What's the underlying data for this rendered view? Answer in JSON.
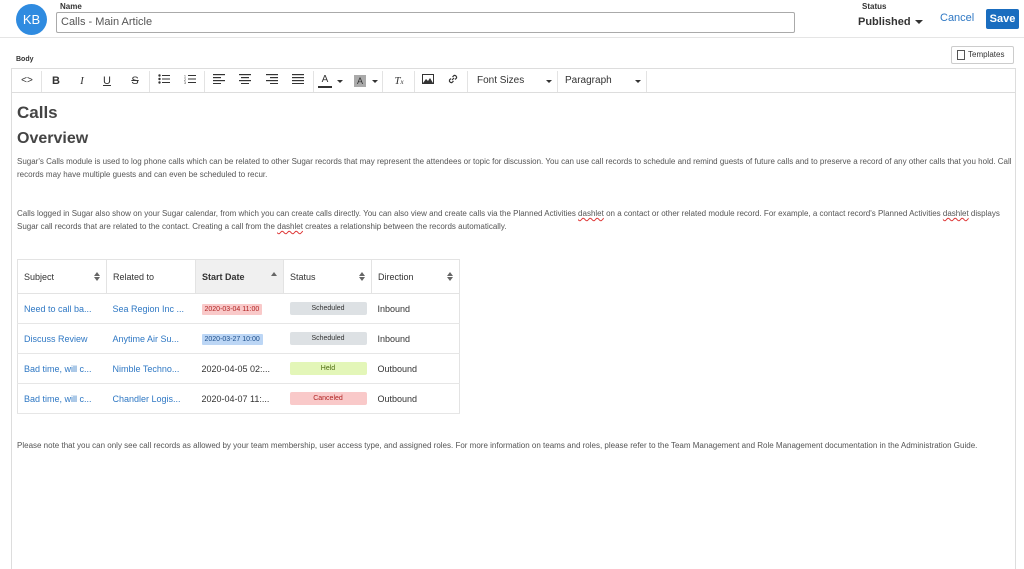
{
  "header": {
    "avatar_initials": "KB",
    "name_label": "Name",
    "name_value": "Calls - Main Article",
    "status_label": "Status",
    "status_value": "Published",
    "cancel_label": "Cancel",
    "save_label": "Save",
    "colors": {
      "avatar": "#2f8be0",
      "save": "#1a6dbf",
      "link": "#2f78c4"
    }
  },
  "body_label": "Body",
  "templates_label": "Templates",
  "toolbar": {
    "buttons": [
      "code-view",
      "bold",
      "italic",
      "underline",
      "strikethrough",
      "bullet-list",
      "numbered-list",
      "align-left",
      "align-center",
      "align-right",
      "align-justify",
      "text-color",
      "background-color",
      "clear-formatting",
      "insert-image",
      "insert-link"
    ],
    "font_sizes_label": "Font Sizes",
    "paragraph_label": "Paragraph"
  },
  "content": {
    "h1": "Calls",
    "h2": "Overview",
    "para1": "Sugar's Calls module is used to log phone calls which can be related to other Sugar records that may represent the attendees or topic for discussion. You can use call records to schedule and remind guests of future calls and to preserve a record of any other calls that you hold. Call records may have multiple guests and can even be scheduled to recur.",
    "para2_a": "Calls logged in Sugar also show on your Sugar calendar, from which you can create calls directly. You can also view and create calls via the Planned Activities ",
    "para2_b": "dashlet",
    "para2_c": " on a contact or other related module record. For example, a contact record's Planned Activities ",
    "para2_d": "dashlet",
    "para2_e": " displays Sugar call records that are related to the contact. Creating a call from the ",
    "para2_f": "dashlet",
    "para2_g": " creates a relationship between the records automatically.",
    "para3": "Please note that you can only see call records as allowed by your team membership, user access type, and assigned roles. For more information on teams and roles, please refer to the Team Management and Role Management documentation in the Administration Guide."
  },
  "table": {
    "columns": [
      "Subject",
      "Related to",
      "Start Date",
      "Status",
      "Direction"
    ],
    "sorted_column": "Start Date",
    "rows": [
      {
        "subject": "Need to call ba...",
        "related": "Sea Region Inc ...",
        "date": "2020-03-04 11:00",
        "date_style": "overdue",
        "status": "Scheduled",
        "status_style": "scheduled",
        "direction": "Inbound"
      },
      {
        "subject": "Discuss Review",
        "related": "Anytime Air Su...",
        "date": "2020-03-27 10:00",
        "date_style": "upcoming",
        "status": "Scheduled",
        "status_style": "scheduled",
        "direction": "Inbound"
      },
      {
        "subject": "Bad time, will c...",
        "related": "Nimble Techno...",
        "date": "2020-04-05 02:...",
        "date_style": "plain",
        "status": "Held",
        "status_style": "held",
        "direction": "Outbound"
      },
      {
        "subject": "Bad time, will c...",
        "related": "Chandler Logis...",
        "date": "2020-04-07 11:...",
        "date_style": "plain",
        "status": "Canceled",
        "status_style": "canceled",
        "direction": "Outbound"
      }
    ],
    "badge_colors": {
      "overdue": {
        "bg": "#f9c9c9",
        "fg": "#b02323"
      },
      "upcoming": {
        "bg": "#bcd6f5",
        "fg": "#1d4e8a"
      },
      "scheduled": {
        "bg": "#dde1e4",
        "fg": "#333333"
      },
      "held": {
        "bg": "#e3f6b8",
        "fg": "#4d6a10"
      },
      "canceled": {
        "bg": "#f9c9c9",
        "fg": "#b02323"
      }
    }
  }
}
